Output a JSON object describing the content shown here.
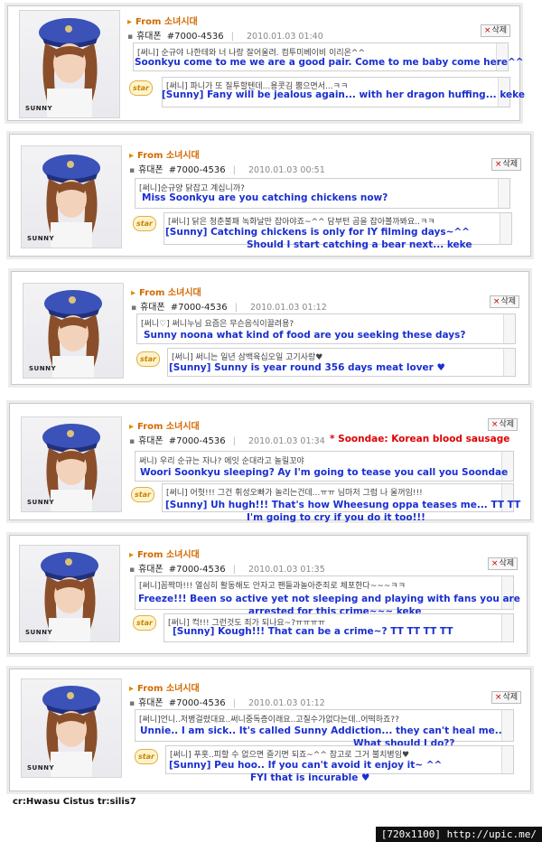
{
  "posts": [
    {
      "from": "From 소녀시대",
      "phone": "휴대폰",
      "number": "#7000-4536",
      "date": "2010.01.03 01:40",
      "delete": "삭제",
      "message_kr": "[써니] 순규야 나한테와 너 나랑 잘어울려. 컴투미베이비 이리온^^",
      "message_en": "Soonkyu come to me we are a good pair. Come to me baby come here^^",
      "reply_kr": "[써니] 파니가 또 질투할텐데...용콧김 뿜으면서...ㅋㅋ",
      "reply_en": [
        "[Sunny] Fany will be jealous again... with her dragon huffing... keke"
      ]
    },
    {
      "from": "From 소녀시대",
      "phone": "휴대폰",
      "number": "#7000-4536",
      "date": "2010.01.03 00:51",
      "delete": "삭제",
      "message_kr": "[써니]순규양 닭잡고 계십니까?",
      "message_en": "Miss Soonkyu are you catching chickens now?",
      "reply_kr": "[써니] 닭은 청춘불패 녹화날만 잡아야죠~^^ 담부턴 곰을 잡아볼까봐요..ㅋㅋ",
      "reply_en": [
        "[Sunny] Catching chickens is only for IY filming days~^^",
        "Should I start catching a bear next... keke"
      ]
    },
    {
      "from": "From 소녀시대",
      "phone": "휴대폰",
      "number": "#7000-4536",
      "date": "2010.01.03 01:12",
      "delete": "삭제",
      "message_kr": "[써니♡] 써니누님 요즘은 무슨음식이끌려용?",
      "message_en": "Sunny noona what kind of food are you seeking these days?",
      "reply_kr": "[써니] 써니는 일년 삼백육십오일 고기사랑♥",
      "reply_en": [
        "[Sunny] Sunny is year round 356 days meat lover ♥"
      ]
    },
    {
      "from": "From 소녀시대",
      "phone": "휴대폰",
      "number": "#7000-4536",
      "date": "2010.01.03 01:34",
      "delete": "삭제",
      "note": "* Soondae: Korean blood sausage",
      "message_kr": "써니) 우리 순규는 자나? 에잇 순대라고 놀릴꼬야",
      "message_en": "Woori Soonkyu sleeping? Ay I'm going to tease you call you Soondae",
      "reply_kr": "[써니] 어헛!!! 그건 휘성오빠가 놀리는건데...ㅠㅠ 님마저 그럼 나 울꺼임!!!",
      "reply_en": [
        "[Sunny] Uh hugh!!! That's how Wheesung oppa teases me... TT TT",
        "I'm going to cry if you do it too!!!"
      ]
    },
    {
      "from": "From 소녀시대",
      "phone": "휴대폰",
      "number": "#7000-4536",
      "date": "2010.01.03 01:35",
      "delete": "삭제",
      "message_kr": "[써니]꼼짝마!!! 열심히 활동해도 안자고 팬들과놀아준죄로 체포한다~~~ㅋㅋ",
      "message_en": [
        "Freeze!!! Been so active yet not sleeping and playing with fans you are",
        "arrested for this crime~~~ keke"
      ],
      "reply_kr": "[써니] 컥!!! 그런것도 죄가 되나요~?ㅠㅠㅠㅠ",
      "reply_en": [
        "[Sunny] Kough!!! That can be a crime~? TT TT TT TT"
      ]
    },
    {
      "from": "From 소녀시대",
      "phone": "휴대폰",
      "number": "#7000-4536",
      "date": "2010.01.03 01:12",
      "delete": "삭제",
      "message_kr": "[써니]언니..저병걸렸대요..써니중독증이래요..고칠수가없다는데..어떡하죠??",
      "message_en": [
        "Unnie.. I am sick.. It's called Sunny Addiction... they can't heal me..",
        "What should I do??"
      ],
      "reply_kr": "[써니] 푸훗..피할 수 없으면 즐기면 되죠~^^ 참고로 그거 불치병임♥",
      "reply_en": [
        "[Sunny] Peu hoo.. If you can't avoid it enjoy it~ ^^",
        "FYI that is incurable ♥"
      ]
    }
  ],
  "badge": "star",
  "logo_text": "SUNNY",
  "credit": "cr:Hwasu Cistus tr:silis7",
  "footer": "[720x1100] http://upic.me/"
}
